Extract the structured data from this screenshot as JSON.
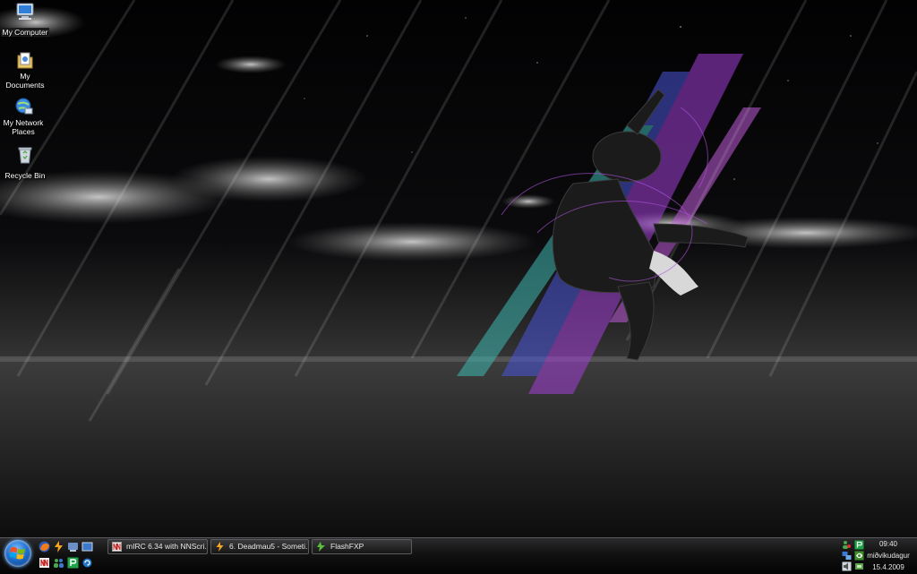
{
  "desktop": {
    "icons": [
      {
        "label": "My Computer",
        "icon": "my-computer-icon"
      },
      {
        "label": "My Documents",
        "icon": "my-documents-icon"
      },
      {
        "label": "My Network Places",
        "icon": "network-places-icon"
      },
      {
        "label": "Recycle Bin",
        "icon": "recycle-bin-icon"
      }
    ]
  },
  "taskbar": {
    "quick_launch": [
      "firefox-icon",
      "winamp-icon",
      "messenger-icon",
      "show-desktop-icon",
      "nn-icon",
      "msn-icon",
      "p-icon",
      "refresh-icon"
    ],
    "tasks": [
      {
        "label": "mIRC 6.34 with NNScri...",
        "icon": "mirc-icon"
      },
      {
        "label": "6. Deadmau5 - Someti...",
        "icon": "winamp-icon"
      },
      {
        "label": "FlashFXP",
        "icon": "flashfxp-icon"
      }
    ],
    "tray": {
      "time": "09:40",
      "day": "miðvikudagur",
      "date": "15.4.2009"
    }
  },
  "colors": {
    "taskbar_top": "#2a2a2c",
    "taskbar_bottom": "#040404",
    "streak_purple": "#a23fd6",
    "streak_teal": "#3fb7b0",
    "streak_blue": "#4a56d8"
  }
}
